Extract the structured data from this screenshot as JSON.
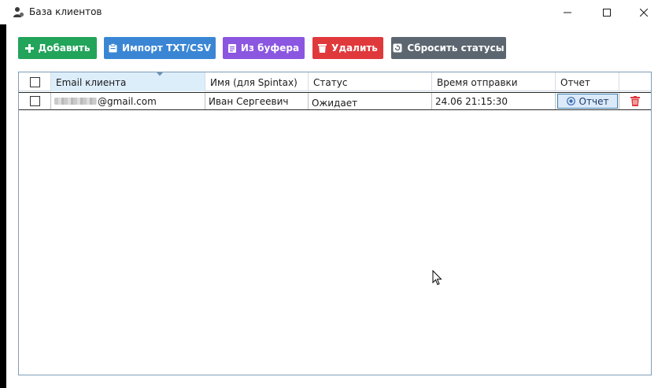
{
  "window": {
    "title": "База клиентов"
  },
  "toolbar": {
    "add_label": "Добавить",
    "import_label": "Импорт TXT/CSV",
    "buffer_label": "Из буфера",
    "delete_label": "Удалить",
    "reset_label": "Сбросить статусы"
  },
  "table": {
    "columns": [
      "",
      "Email клиента",
      "Имя (для Spintax)",
      "Статус",
      "Время отправки",
      "Отчет",
      ""
    ],
    "rows": [
      {
        "email_suffix": "@gmail.com",
        "name": "Иван Сергеевич",
        "status": "Ожидает",
        "sent_time": "24.06 21:15:30",
        "report_label": "Отчет"
      }
    ]
  },
  "colors": {
    "add": "#22a45a",
    "import": "#3a86d4",
    "buffer": "#8b56e0",
    "delete": "#e0393c",
    "reset": "#5c6670"
  }
}
